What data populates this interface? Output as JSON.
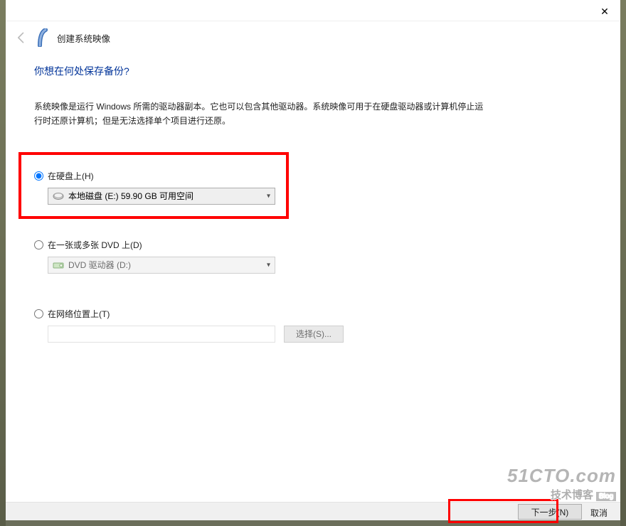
{
  "window": {
    "app_title": "创建系统映像",
    "close_tooltip": "关闭"
  },
  "page": {
    "heading": "你想在何处保存备份?",
    "description": "系统映像是运行 Windows 所需的驱动器副本。它也可以包含其他驱动器。系统映像可用于在硬盘驱动器或计算机停止运行时还原计算机；但是无法选择单个项目进行还原。"
  },
  "options": {
    "hard_disk": {
      "label": "在硬盘上(H)",
      "selected_text": "本地磁盘 (E:)  59.90 GB 可用空间",
      "checked": true
    },
    "dvd": {
      "label": "在一张或多张 DVD 上(D)",
      "selected_text": "DVD 驱动器 (D:)",
      "checked": false
    },
    "network": {
      "label": "在网络位置上(T)",
      "path_value": "",
      "browse_label": "选择(S)...",
      "checked": false
    }
  },
  "footer": {
    "next_label": "下一步(N)",
    "cancel_label": "取消"
  },
  "watermark": {
    "line1": "51CTO.com",
    "line2_main": "技术博客",
    "line2_tag": "Blog"
  }
}
